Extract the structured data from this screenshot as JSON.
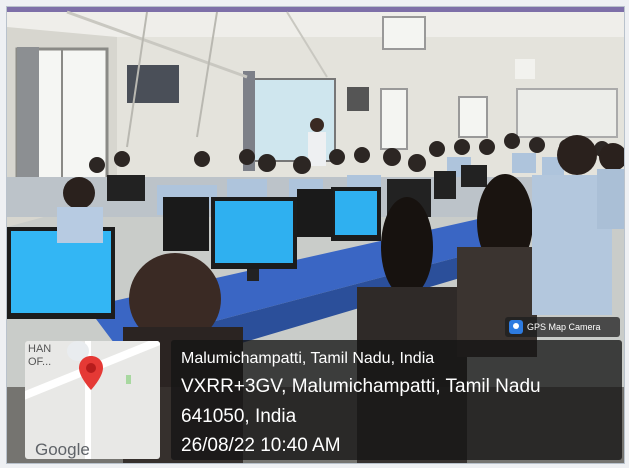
{
  "photo": {
    "description_icon": "classroom-photo",
    "colors": {
      "wall": "#e7e6e0",
      "desk": "#3a66c4",
      "screen": "#2fb0f0",
      "uniform": "#aec4dc"
    }
  },
  "badge": {
    "icon": "camera-icon",
    "label": "GPS Map Camera"
  },
  "location": {
    "line1": "Malumichampatti, Tamil Nadu, India",
    "line2": "VXRR+3GV, Malumichampatti, Tamil Nadu",
    "line3": "641050, India",
    "line4": "26/08/22 10:40 AM"
  },
  "map": {
    "label": "HAN\nOF...",
    "brand": "Google",
    "pin_icon": "map-pin-icon",
    "pin_color": "#e53935"
  }
}
